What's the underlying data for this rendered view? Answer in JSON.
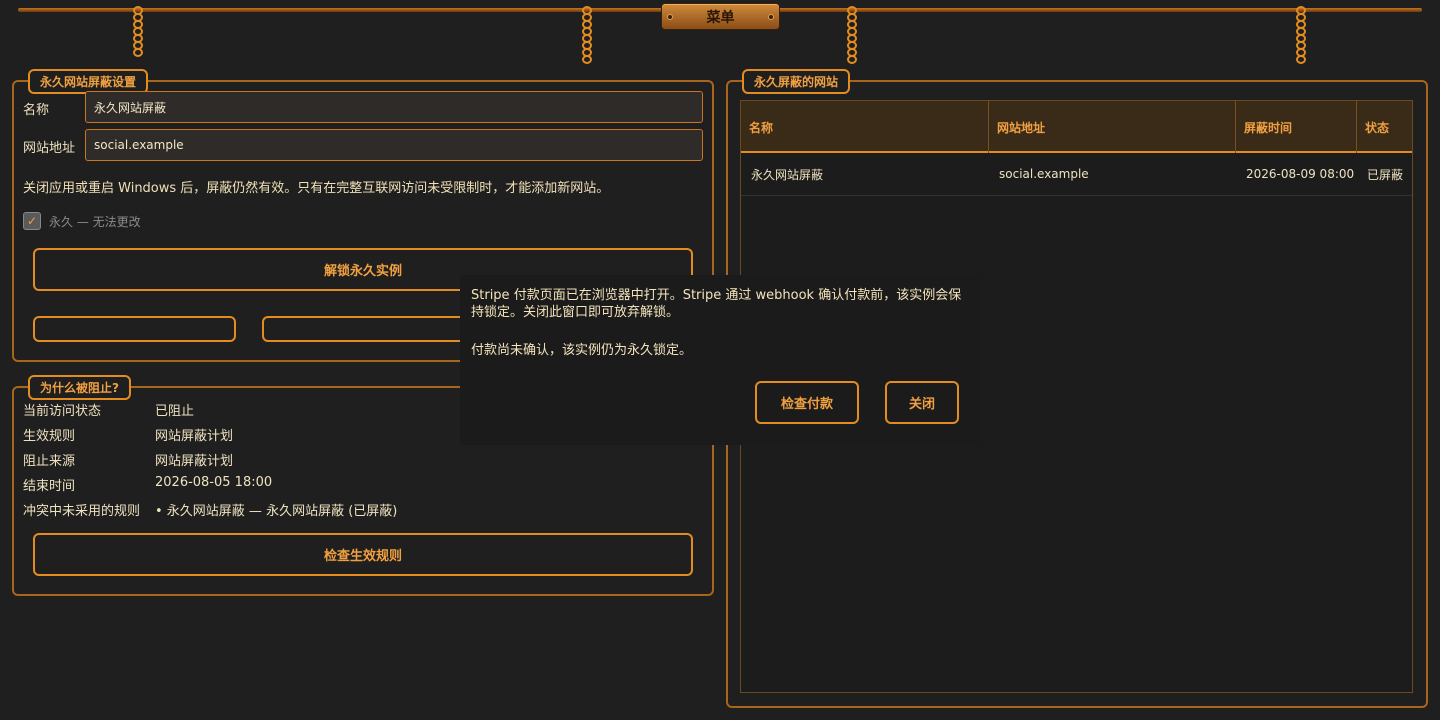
{
  "menu": {
    "label": "菜单"
  },
  "settings_panel": {
    "title": "永久网站屏蔽设置",
    "name_label": "名称",
    "name_value": "永久网站屏蔽",
    "url_label": "网站地址",
    "url_value": "social.example",
    "note": "关闭应用或重启 Windows 后，屏蔽仍然有效。只有在完整互联网访问未受限制时，才能添加新网站。",
    "permanent_label": "永久 — 无法更改",
    "unlock_button": "解锁永久实例"
  },
  "why_panel": {
    "title": "为什么被阻止?",
    "rows": [
      {
        "label": "当前访问状态",
        "value": "已阻止"
      },
      {
        "label": "生效规则",
        "value": "网站屏蔽计划"
      },
      {
        "label": "阻止来源",
        "value": "网站屏蔽计划"
      },
      {
        "label": "结束时间",
        "value": "2026-08-05 18:00"
      },
      {
        "label": "冲突中未采用的规则",
        "value": "• 永久网站屏蔽 — 永久网站屏蔽 (已屏蔽)"
      }
    ],
    "check_button": "检查生效规则"
  },
  "sites_panel": {
    "title": "永久屏蔽的网站",
    "columns": [
      "名称",
      "网站地址",
      "屏蔽时间",
      "状态"
    ],
    "rows": [
      [
        "永久网站屏蔽",
        "social.example",
        "2026-08-09 08:00",
        "已屏蔽"
      ]
    ]
  },
  "dialog": {
    "message": "Stripe 付款页面已在浏览器中打开。Stripe 通过 webhook 确认付款前，该实例会保持锁定。关闭此窗口即可放弃解锁。",
    "status": "付款尚未确认，该实例仍为永久锁定。",
    "check_payment": "检查付款",
    "close": "关闭"
  },
  "colors": {
    "accent": "#e38c20",
    "background": "#1f1f1f",
    "text": "#efe2c0"
  }
}
